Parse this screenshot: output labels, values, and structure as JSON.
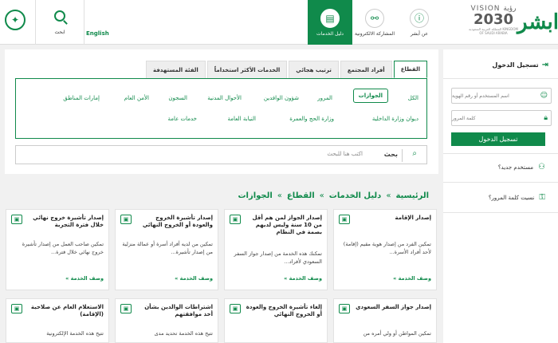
{
  "header": {
    "logo_mark": "ابشر",
    "vision_top": "VISION رؤية",
    "vision_year": "2030",
    "vision_sub": "المملكة العربية السعودية KINGDOM OF SAUDI ARABIA",
    "nav": [
      {
        "label": "عن أبشر"
      },
      {
        "label": "المشاركة الالكترونية"
      },
      {
        "label": "دليل الخدمات"
      }
    ],
    "search_label": "ابحث",
    "lang_label": "English"
  },
  "sidebar": {
    "title": "تسجيل الدخول",
    "username_placeholder": "اسم المستخدم أو رقم الهوية",
    "password_placeholder": "كلمة المرور",
    "login_button": "تسجيل الدخول",
    "new_user": "مستخدم جديد؟",
    "forgot_password": "نسيت كلمة المرور؟"
  },
  "filter": {
    "tabs": [
      "القطاع",
      "أفراد المجتمع",
      "ترتيب هجائي",
      "الخدمات الأكثر استخداماً",
      "الفئة المستهدفة"
    ],
    "chips_row1": [
      "الكل",
      "الجوازات",
      "المرور",
      "شؤون الوافدين",
      "الأحوال المدنية",
      "السجون",
      "الأمن العام",
      "إمارات المناطق"
    ],
    "chips_row2": [
      "ديوان وزارة الداخلية",
      "وزارة الحج والعمرة",
      "النيابة العامة",
      "خدمات عامة"
    ],
    "search_label": "بحث",
    "search_placeholder": "اكتب هنا للبحث"
  },
  "breadcrumb": [
    "الرئيسية",
    "دليل الخدمات",
    "القطاع",
    "الجوازات"
  ],
  "cards": [
    {
      "title": "إصدار الإقامة",
      "desc": "تمكين الفرد من إصدار هوية مقيم (إقامة) لأحد أفراد الأسرة...",
      "more": "وصف الخدمة »"
    },
    {
      "title": "إصدار الجواز لمن هم أقل من 10 سنة وليس لديهم بصمة في النظام",
      "desc": "تمكنك هذه الخدمة من إصدار جواز السفر السعودي لأفراد...",
      "more": "وصف الخدمة »"
    },
    {
      "title": "إصدار تأشيرة الخروج والعودة أو الخروج النهائي",
      "desc": "تمكين من لديه أفراد أسرة أو عمالة منزلية من إصدار تأشيرة...",
      "more": "وصف الخدمة »"
    },
    {
      "title": "إصدار تأشيرة خروج نهائي خلال فترة التجربة",
      "desc": "تمكين صاحب العمل من إصدار تأشيرة خروج نهائي خلال فترة...",
      "more": "وصف الخدمة »"
    },
    {
      "title": "إصدار جواز السفر السعودي",
      "desc": "تمكين المواطن أو ولي أمره من",
      "more": ""
    },
    {
      "title": "إلغاء تأشيرة الخروج والعودة أو الخروج النهائي",
      "desc": "",
      "more": ""
    },
    {
      "title": "اشتراطات الوالدين بشأن أخذ موافقتهم",
      "desc": "تتيح هذه الخدمة تحديد مدى",
      "more": ""
    },
    {
      "title": "الاستعلام العام عن صلاحية (الإقامة)",
      "desc": "تتيح هذه الخدمة الإلكترونية",
      "more": ""
    }
  ]
}
